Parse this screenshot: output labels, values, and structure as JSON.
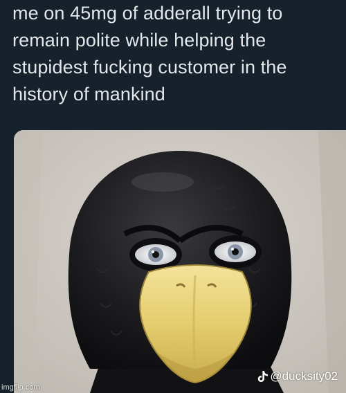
{
  "tweet": {
    "text_lines": [
      "me on 45mg of adderall trying to",
      "remain polite while helping the",
      "stupidest fucking customer in the",
      "history of mankind"
    ]
  },
  "media": {
    "watermark_handle": "@ducksity02",
    "watermark_icon": "tiktok-icon"
  },
  "site_watermark": "imgflip.com",
  "colors": {
    "background": "#16212c",
    "text": "#e4e7ea",
    "mask_black": "#1b1b1d",
    "beak_yellow": "#e8d27a",
    "wall": "#cfcbc4"
  }
}
